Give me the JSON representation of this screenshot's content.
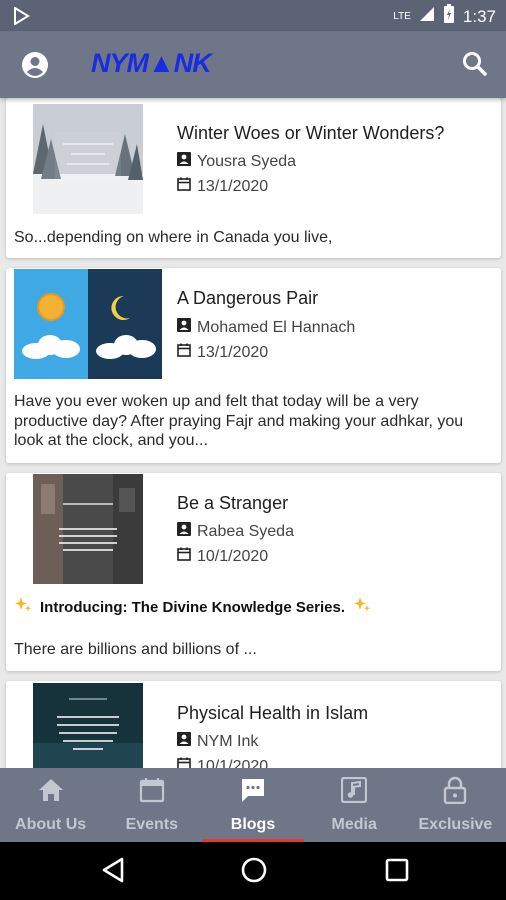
{
  "status_bar": {
    "network": "LTE",
    "time": "1:37"
  },
  "app_bar": {
    "logo": "NYM▲NK"
  },
  "posts": [
    {
      "title": "Winter Woes or Winter Wonders?",
      "author": "Yousra Syeda",
      "date": "13/1/2020",
      "excerpt": "So...depending on where in Canada you live,"
    },
    {
      "title": "A Dangerous Pair",
      "author": "Mohamed El Hannach",
      "date": "13/1/2020",
      "excerpt": "Have you ever woken up and felt that today will be a very productive day? After praying Fajr and making your adhkar, you look at the clock, and you..."
    },
    {
      "title": "Be a Stranger",
      "author": "Rabea Syeda",
      "date": "10/1/2020",
      "intro": "Introducing: The Divine Knowledge Series.",
      "excerpt": "There are billions and billions of ..."
    },
    {
      "title": "Physical Health in Islam",
      "author": "NYM Ink",
      "date": "10/1/2020"
    }
  ],
  "bottom_nav": [
    {
      "label": "About Us",
      "icon": "home-icon"
    },
    {
      "label": "Events",
      "icon": "calendar-icon"
    },
    {
      "label": "Blogs",
      "icon": "chat-icon",
      "active": true
    },
    {
      "label": "Media",
      "icon": "music-note-icon"
    },
    {
      "label": "Exclusive",
      "icon": "lock-icon"
    }
  ],
  "colors": {
    "status_bar": "#5b6375",
    "app_bar": "#6f7688",
    "logo": "#1a2ce0",
    "active_indicator": "#e23b2e"
  }
}
